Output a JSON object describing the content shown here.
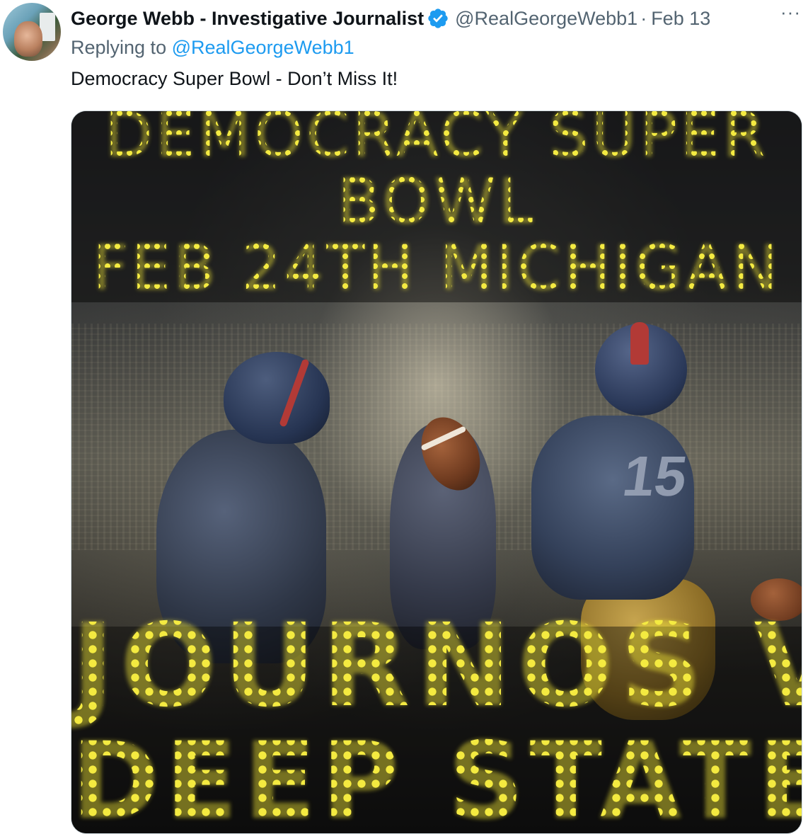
{
  "tweet": {
    "author_name": "George Webb - Investigative Journalist",
    "verified_icon": "verified-badge-icon",
    "handle": "@RealGeorgeWebb1",
    "separator": "·",
    "date": "Feb 13",
    "more_label": "···",
    "replying_prefix": "Replying to ",
    "replying_to": "@RealGeorgeWebb1",
    "text": "Democracy Super Bowl - Don’t Miss It!"
  },
  "media": {
    "line1": "DEMOCRACY SUPER",
    "line2": "BOWL",
    "line3": "FEB 24TH MICHIGAN",
    "line4": "JOURNOS V",
    "line5": "DEEP STATE",
    "jersey_number": "15"
  },
  "colors": {
    "link": "#1d9bf0",
    "muted": "#536471",
    "text": "#0f1419",
    "marquee": "#f5ec48"
  }
}
